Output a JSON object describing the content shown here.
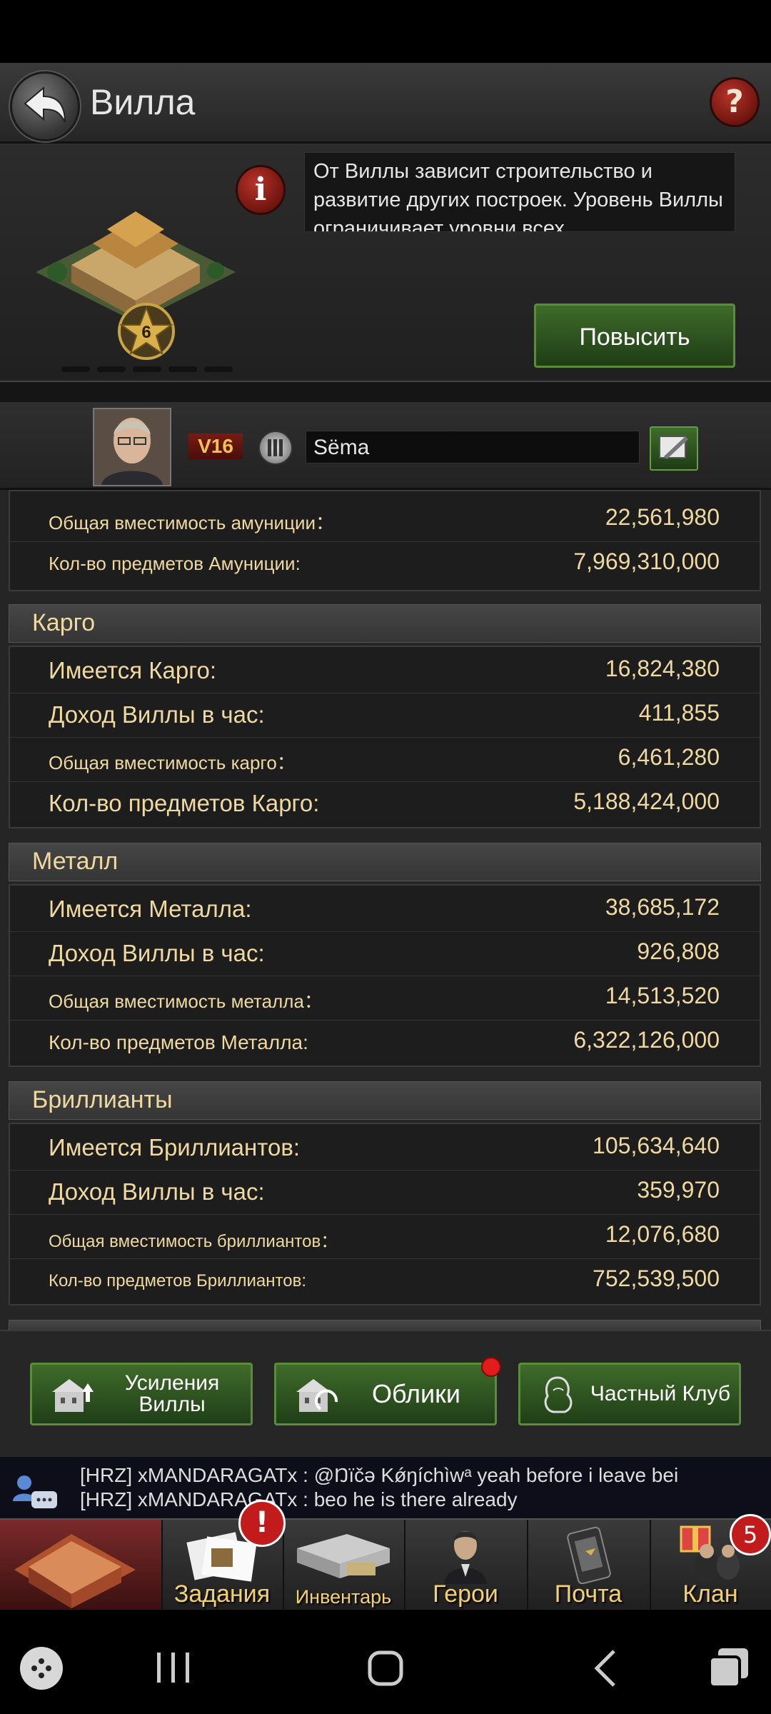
{
  "header": {
    "title": "Вилла",
    "help_label": "?"
  },
  "info": {
    "description": "От Виллы зависит строительство и развитие других построек. Уровень Виллы ограничивает уровни всех",
    "level": "6",
    "info_label": "i",
    "upgrade_label": "Повысить"
  },
  "user": {
    "vip": "V16",
    "name": "Sëma"
  },
  "ammo_rows": [
    {
      "label": "Общая вместимость амуниции：",
      "value": "22,561,980"
    },
    {
      "label": "Кол-во предметов Амуниции:",
      "value": "7,969,310,000"
    }
  ],
  "sections": [
    {
      "title": "Карго",
      "rows": [
        {
          "label": "Имеется Карго:",
          "value": "16,824,380"
        },
        {
          "label": "Доход Виллы в час:",
          "value": "411,855"
        },
        {
          "label": "Общая вместимость карго：",
          "value": "6,461,280"
        },
        {
          "label": "Кол-во предметов Карго:",
          "value": "5,188,424,000"
        }
      ]
    },
    {
      "title": "Металл",
      "rows": [
        {
          "label": "Имеется Металла:",
          "value": "38,685,172"
        },
        {
          "label": "Доход Виллы в час:",
          "value": "926,808"
        },
        {
          "label": "Общая вместимость металла：",
          "value": "14,513,520"
        },
        {
          "label": "Кол-во предметов Металла:",
          "value": "6,322,126,000"
        }
      ]
    },
    {
      "title": "Бриллианты",
      "rows": [
        {
          "label": "Имеется Бриллиантов:",
          "value": "105,634,640"
        },
        {
          "label": "Доход Виллы в час:",
          "value": "359,970"
        },
        {
          "label": "Общая вместимость бриллиантов：",
          "value": "12,076,680"
        },
        {
          "label": "Кол-во предметов Бриллиантов:",
          "value": "752,539,500"
        }
      ]
    }
  ],
  "actions": {
    "boosts": "Усиления Виллы",
    "skins": "Облики",
    "club": "Частный Клуб"
  },
  "chat": {
    "line1": "[HRZ] xMANDARAGATx : @Ŋïčə Κǿŋíchìwᵃ yeah before i leave bei",
    "line2": "[HRZ] xMANDARAGATx : beo he is there already"
  },
  "nav": {
    "tasks": "Задания",
    "inventory": "Инвентарь",
    "heroes": "Герои",
    "mail": "Почта",
    "clan": "Клан",
    "tasks_badge": "!",
    "clan_badge": "5"
  },
  "colors": {
    "accent_gold": "#efd9a0",
    "button_green": "#3f6b2b",
    "alert_red": "#c21b1b"
  }
}
